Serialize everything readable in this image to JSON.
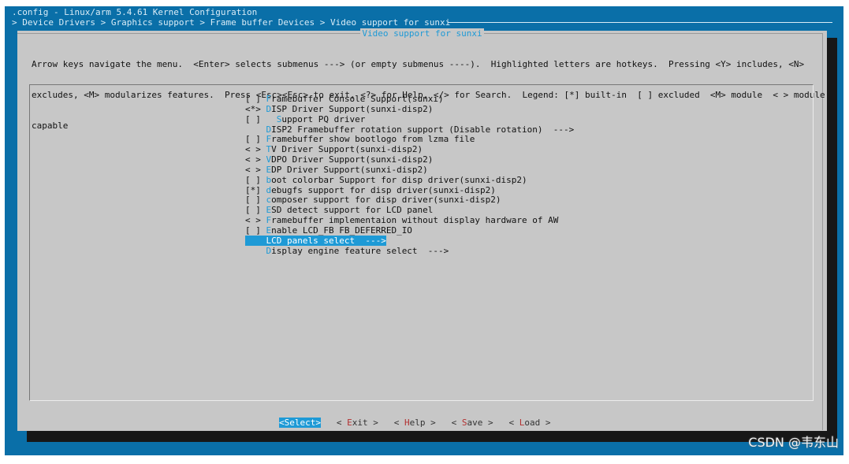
{
  "window": {
    "title": ".config - Linux/arm 5.4.61 Kernel Configuration",
    "breadcrumb": "> Device Drivers > Graphics support > Frame buffer Devices > Video support for sunxi"
  },
  "dialog": {
    "title": "Video support for sunxi",
    "instructions": [
      "Arrow keys navigate the menu.  <Enter> selects submenus ---> (or empty submenus ----).  Highlighted letters are hotkeys.  Pressing <Y> includes, <N>",
      "excludes, <M> modularizes features.  Press <Esc><Esc> to exit, <?> for Help, </> for Search.  Legend: [*] built-in  [ ] excluded  <M> module  < > module",
      "capable"
    ]
  },
  "menu": {
    "items": [
      {
        "ind": "[ ] ",
        "pad": "",
        "hk": "F",
        "rest": "ramebuffer Console Support(sunxi)"
      },
      {
        "ind": "<*> ",
        "pad": "",
        "hk": "D",
        "rest": "ISP Driver Support(sunxi-disp2)"
      },
      {
        "ind": "[ ] ",
        "pad": "  ",
        "hk": "S",
        "rest": "upport PQ driver"
      },
      {
        "ind": "    ",
        "pad": "",
        "hk": "D",
        "rest": "ISP2 Framebuffer rotation support (Disable rotation)  --->"
      },
      {
        "ind": "[ ] ",
        "pad": "",
        "hk": "F",
        "rest": "ramebuffer show bootlogo from lzma file"
      },
      {
        "ind": "< > ",
        "pad": "",
        "hk": "T",
        "rest": "V Driver Support(sunxi-disp2)"
      },
      {
        "ind": "< > ",
        "pad": "",
        "hk": "V",
        "rest": "DPO Driver Support(sunxi-disp2)"
      },
      {
        "ind": "< > ",
        "pad": "",
        "hk": "E",
        "rest": "DP Driver Support(sunxi-disp2)"
      },
      {
        "ind": "[ ] ",
        "pad": "",
        "hk": "b",
        "rest": "oot colorbar Support for disp driver(sunxi-disp2)"
      },
      {
        "ind": "[*] ",
        "pad": "",
        "hk": "d",
        "rest": "ebugfs support for disp driver(sunxi-disp2)"
      },
      {
        "ind": "[ ] ",
        "pad": "",
        "hk": "c",
        "rest": "omposer support for disp driver(sunxi-disp2)"
      },
      {
        "ind": "[ ] ",
        "pad": "",
        "hk": "E",
        "rest": "SD detect support for LCD panel"
      },
      {
        "ind": "< > ",
        "pad": "",
        "hk": "F",
        "rest": "ramebuffer implementaion without display hardware of AW"
      },
      {
        "ind": "[ ] ",
        "pad": "",
        "hk": "E",
        "rest": "nable LCD_FB FB_DEFERRED_IO"
      },
      {
        "ind": "    ",
        "pad": "",
        "hk": "L",
        "rest": "CD panels select  --->",
        "selected": true
      },
      {
        "ind": "    ",
        "pad": "",
        "hk": "D",
        "rest": "isplay engine feature select  --->"
      }
    ]
  },
  "buttons": [
    {
      "pre": "<",
      "hk": "S",
      "post": "elect>",
      "active": true
    },
    {
      "pre": "< ",
      "hk": "E",
      "post": "xit >",
      "active": false
    },
    {
      "pre": "< ",
      "hk": "H",
      "post": "elp >",
      "active": false
    },
    {
      "pre": "< ",
      "hk": "S",
      "post": "ave >",
      "active": false
    },
    {
      "pre": "< ",
      "hk": "L",
      "post": "oad >",
      "active": false
    }
  ],
  "watermark": "CSDN @韦东山",
  "colors": {
    "terminal_bg": "#0a6fa8",
    "dialog_bg": "#c7c7c7",
    "accent": "#1e9ad6",
    "hotkey_button": "#b23030"
  }
}
